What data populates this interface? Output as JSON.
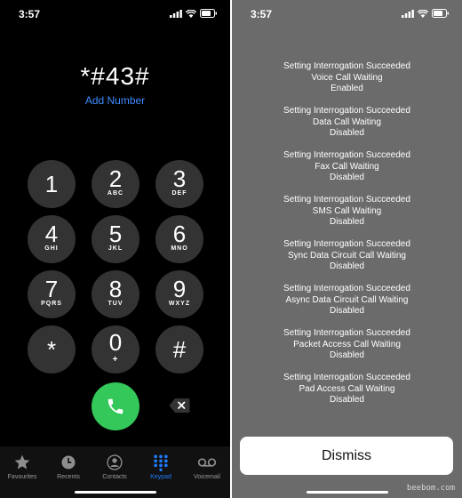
{
  "left_screen": {
    "status_time": "3:57",
    "dialed_number": "*#43#",
    "add_number_label": "Add Number",
    "keys": [
      {
        "digit": "1",
        "letters": ""
      },
      {
        "digit": "2",
        "letters": "ABC"
      },
      {
        "digit": "3",
        "letters": "DEF"
      },
      {
        "digit": "4",
        "letters": "GHI"
      },
      {
        "digit": "5",
        "letters": "JKL"
      },
      {
        "digit": "6",
        "letters": "MNO"
      },
      {
        "digit": "7",
        "letters": "PQRS"
      },
      {
        "digit": "8",
        "letters": "TUV"
      },
      {
        "digit": "9",
        "letters": "WXYZ"
      },
      {
        "digit": "*",
        "letters": ""
      },
      {
        "digit": "0",
        "letters": "+"
      },
      {
        "digit": "#",
        "letters": ""
      }
    ],
    "call_icon": "phone-icon",
    "delete_icon": "backspace-icon",
    "tabs": [
      {
        "label": "Favourites",
        "icon": "star-icon",
        "active": false
      },
      {
        "label": "Recents",
        "icon": "clock-icon",
        "active": false
      },
      {
        "label": "Contacts",
        "icon": "person-icon",
        "active": false
      },
      {
        "label": "Keypad",
        "icon": "keypad-icon",
        "active": true
      },
      {
        "label": "Voicemail",
        "icon": "voicemail-icon",
        "active": false
      }
    ]
  },
  "right_screen": {
    "status_time": "3:57",
    "results": [
      {
        "line1": "Setting Interrogation Succeeded",
        "line2": "Voice Call Waiting",
        "line3": "Enabled"
      },
      {
        "line1": "Setting Interrogation Succeeded",
        "line2": "Data Call Waiting",
        "line3": "Disabled"
      },
      {
        "line1": "Setting Interrogation Succeeded",
        "line2": "Fax Call Waiting",
        "line3": "Disabled"
      },
      {
        "line1": "Setting Interrogation Succeeded",
        "line2": "SMS Call Waiting",
        "line3": "Disabled"
      },
      {
        "line1": "Setting Interrogation Succeeded",
        "line2": "Sync Data Circuit Call Waiting",
        "line3": "Disabled"
      },
      {
        "line1": "Setting Interrogation Succeeded",
        "line2": "Async Data Circuit Call Waiting",
        "line3": "Disabled"
      },
      {
        "line1": "Setting Interrogation Succeeded",
        "line2": "Packet Access Call Waiting",
        "line3": "Disabled"
      },
      {
        "line1": "Setting Interrogation Succeeded",
        "line2": "Pad Access Call Waiting",
        "line3": "Disabled"
      }
    ],
    "dismiss_label": "Dismiss"
  },
  "watermark": "beebom.com",
  "colors": {
    "call_green": "#34c759",
    "active_tab_blue": "#1f7bff",
    "link_blue": "#3f8cff",
    "key_gray": "#333333"
  }
}
